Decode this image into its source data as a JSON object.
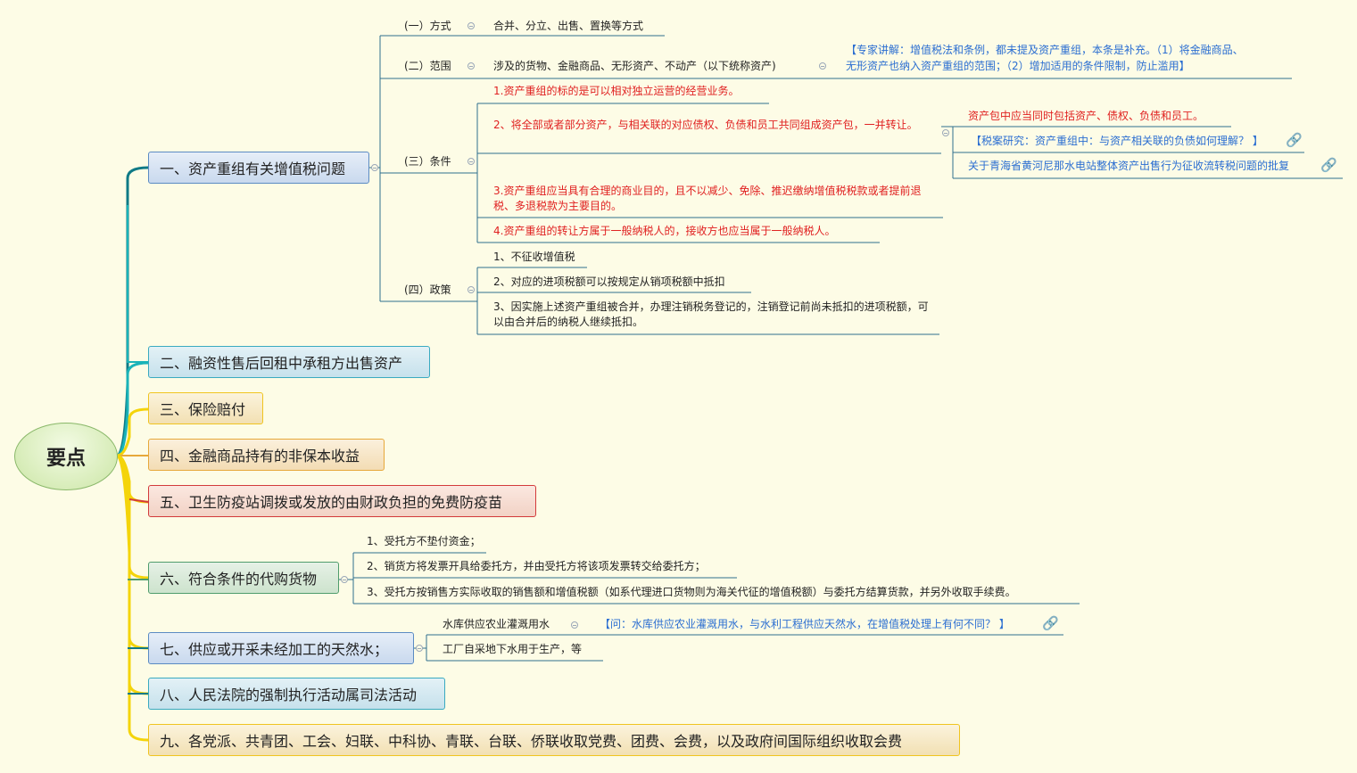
{
  "root": {
    "label": "要点"
  },
  "topics": [
    {
      "label": "一、资产重组有关增值税问题",
      "children": [
        {
          "label": "(一）方式",
          "detail": "合并、分立、出售、置换等方式"
        },
        {
          "label": "(二）范围",
          "detail": "涉及的货物、金融商品、无形资产、不动产（以下统称资产)",
          "note_line1": "【专家讲解：增值税法和条例，都未提及资产重组，本条是补充。（1）将金融商品、",
          "note_line2": "无形资产也纳入资产重组的范围；（2）增加适用的条件限制，防止滥用】"
        },
        {
          "label": "(三）条件",
          "items": [
            "1.资产重组的标的是可以相对独立运营的经营业务。",
            "2、将全部或者部分资产，与相关联的对应债权、负债和员工共同组成资产包，一并转让。",
            "3.资产重组应当具有合理的商业目的，且不以减少、免除、推迟缴纳增值税税款或者提前退税、多退税款为主要目的。",
            "4.资产重组的转让方属于一般纳税人的，接收方也应当属于一般纳税人。"
          ],
          "sub": [
            "资产包中应当同时包括资产、债权、负债和员工。",
            "【税案研究：资产重组中：与资产相关联的负债如何理解？ 】",
            "关于青海省黄河尼那水电站整体资产出售行为征收流转税问题的批复"
          ]
        },
        {
          "label": "(四）政策",
          "items": [
            "1、不征收增值税",
            "2、对应的进项税额可以按规定从销项税额中抵扣",
            "3、因实施上述资产重组被合并，办理注销税务登记的，注销登记前尚未抵扣的进项税额，可以由合并后的纳税人继续抵扣。"
          ]
        }
      ]
    },
    {
      "label": "二、融资性售后回租中承租方出售资产"
    },
    {
      "label": "三、保险赔付"
    },
    {
      "label": "四、金融商品持有的非保本收益"
    },
    {
      "label": "五、卫生防疫站调拨或发放的由财政负担的免费防疫苗"
    },
    {
      "label": "六、符合条件的代购货物",
      "items": [
        "1、受托方不垫付资金；",
        "2、销货方将发票开具给委托方，并由受托方将该项发票转交给委托方；",
        "3、受托方按销售方实际收取的销售额和增值税额（如系代理进口货物则为海关代征的增值税额）与委托方结算货款，并另外收取手续费。"
      ]
    },
    {
      "label": "七、供应或开采未经加工的天然水；",
      "items": [
        "水库供应农业灌溉用水",
        "工厂自采地下水用于生产，等"
      ],
      "note": "【问：水库供应农业灌溉用水，与水利工程供应天然水，在增值税处理上有何不同？ 】"
    },
    {
      "label": "八、人民法院的强制执行活动属司法活动"
    },
    {
      "label": "九、各党派、共青团、工会、妇联、中科协、青联、台联、侨联收取党费、团费、会费，以及政府间国际组织收取会费"
    }
  ],
  "colors": {
    "branch_teal": "#0f7a86",
    "branch_cyan": "#1ab3b8",
    "branch_yellow": "#f4d40a",
    "line": "#2f6f8f",
    "note_blue": "#2b6ed1",
    "condition_red": "#e02020"
  },
  "icons": [
    "link-icon",
    "collapse-toggle-icon"
  ]
}
